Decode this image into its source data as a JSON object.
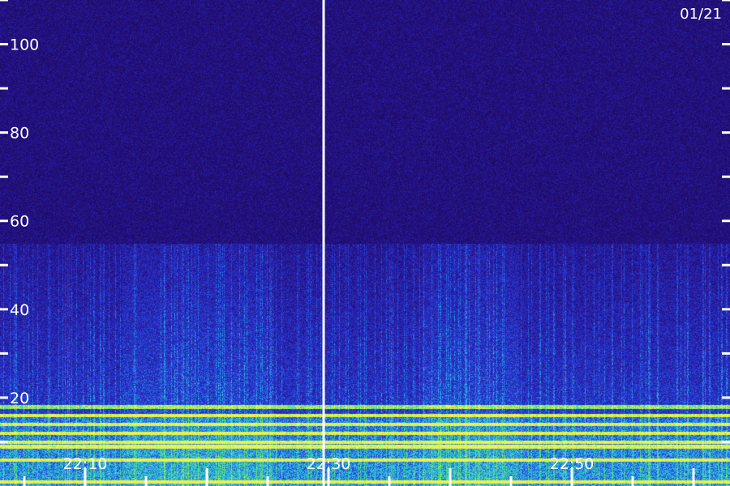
{
  "date_label": "01/21",
  "colors": {
    "background": "#1a0a5a",
    "low": "#1e0e6b",
    "mid": "#2a3ad0",
    "high": "#2bd8e6",
    "peak": "#7cf03c",
    "marker": "#ffffff"
  },
  "chart_data": {
    "type": "heatmap",
    "title": "",
    "xlabel": "",
    "ylabel": "",
    "y_ticks": [
      "20",
      "40",
      "60",
      "80",
      "100"
    ],
    "ylim": [
      0,
      110
    ],
    "x_ticks": [
      "22:10",
      "22:30",
      "22:50"
    ],
    "xlim": [
      "22:03",
      "23:03"
    ],
    "grid": false,
    "strong_bands_y": [
      1,
      6,
      9,
      10,
      12,
      14,
      16,
      18
    ],
    "broadband_cutoff_y": 55,
    "marker_time": "22:30"
  }
}
